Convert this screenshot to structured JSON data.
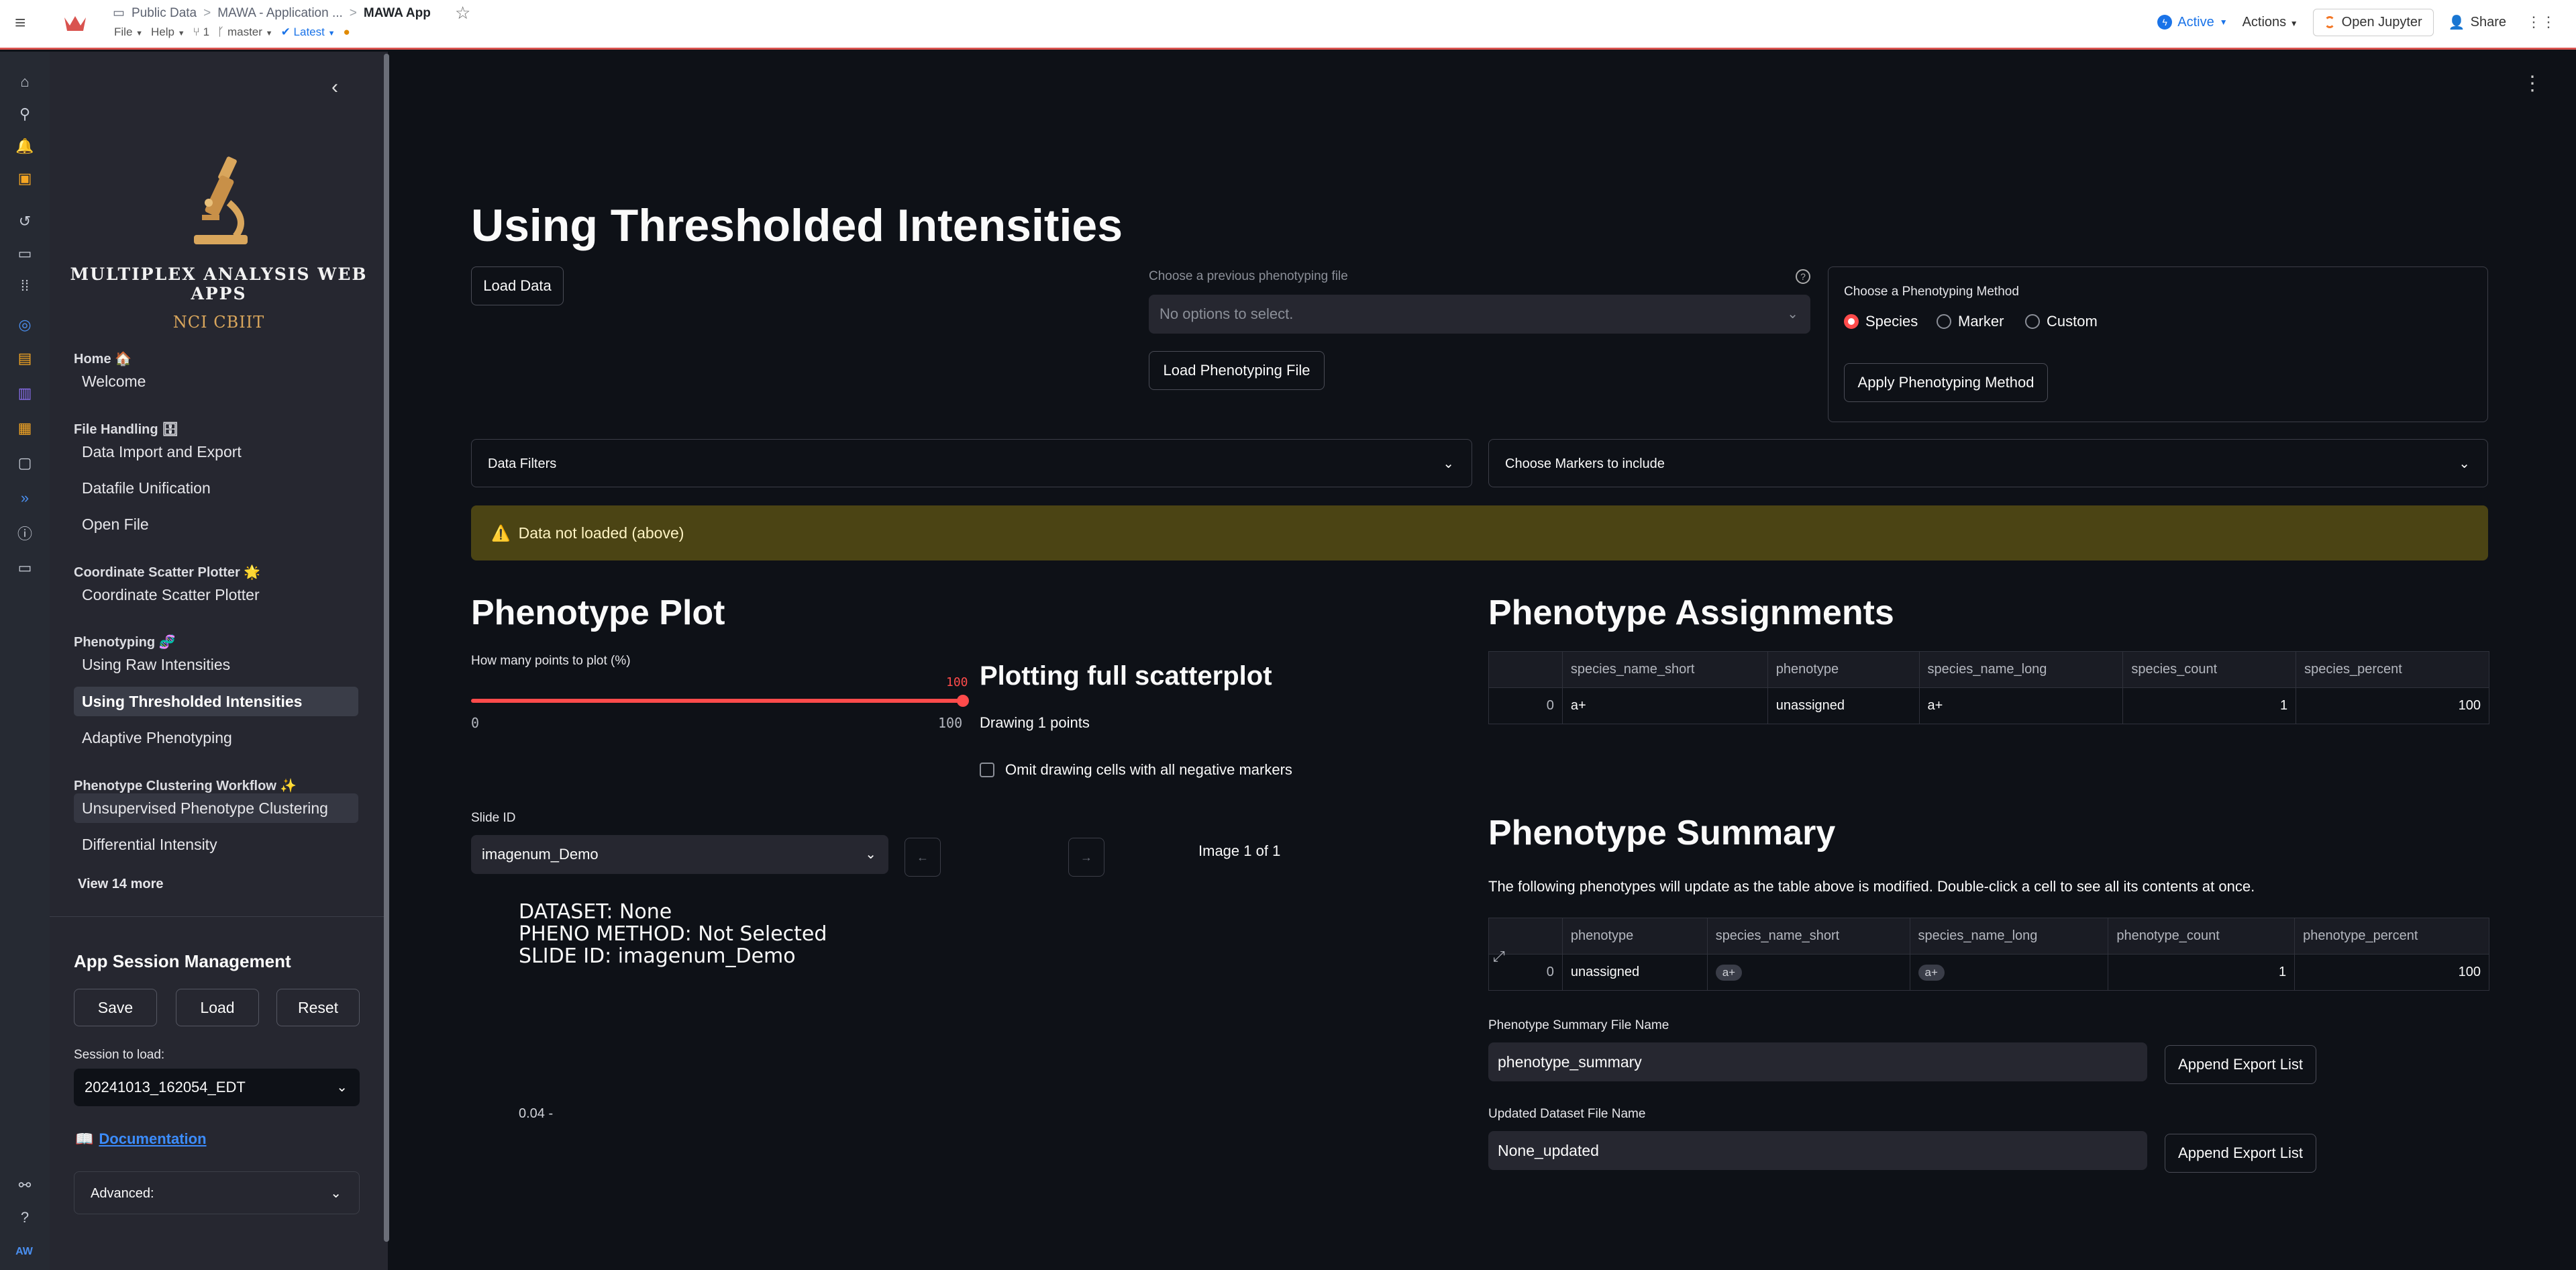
{
  "topbar": {
    "breadcrumb": [
      "Public Data",
      "MAWA - Application ...",
      "MAWA App"
    ],
    "menus": [
      "File",
      "Help"
    ],
    "branch_count": "1",
    "branch": "master",
    "version": "Latest",
    "status": "Active",
    "actions": "Actions",
    "open_jupyter": "Open Jupyter",
    "share": "Share"
  },
  "rail": {
    "avatar": "AW"
  },
  "sidebar": {
    "brand_title": "MULTIPLEX ANALYSIS WEB APPS",
    "brand_sub": "NCI CBIIT",
    "sections": [
      {
        "header": "Home 🏠",
        "items": [
          "Welcome"
        ]
      },
      {
        "header": "File Handling 🗄",
        "items": [
          "Data Import and Export",
          "Datafile Unification",
          "Open File"
        ]
      },
      {
        "header": "Coordinate Scatter Plotter 🌟",
        "items": [
          "Coordinate Scatter Plotter"
        ]
      },
      {
        "header": "Phenotyping 🧬",
        "items": [
          "Using Raw Intensities",
          "Using Thresholded Intensities",
          "Adaptive Phenotyping"
        ]
      },
      {
        "header": "Phenotype Clustering Workflow ✨",
        "items": [
          "Unsupervised Phenotype Clustering",
          "Differential Intensity"
        ]
      }
    ],
    "view_more": "View 14 more",
    "session_title": "App Session Management",
    "save": "Save",
    "load": "Load",
    "reset": "Reset",
    "session_label": "Session to load:",
    "session_value": "20241013_162054_EDT",
    "doc_link": "Documentation",
    "advanced": "Advanced:"
  },
  "main": {
    "title": "Using Thresholded Intensities",
    "load_data": "Load Data",
    "prev_file_label": "Choose a previous phenotyping file",
    "prev_file_placeholder": "No options to select.",
    "load_pheno_file": "Load Phenotyping File",
    "method_label": "Choose a Phenotyping Method",
    "methods": [
      "Species",
      "Marker",
      "Custom"
    ],
    "method_selected": "Species",
    "apply_method": "Apply Phenotyping Method",
    "data_filters": "Data Filters",
    "choose_markers": "Choose Markers to include",
    "warning": "Data not loaded (above)",
    "plot_title": "Phenotype Plot",
    "slider_label": "How many points to plot (%)",
    "slider_value": "100",
    "slider_min": "0",
    "slider_max": "100",
    "slider_fraction": 1.0,
    "plotting_title": "Plotting full scatterplot",
    "drawing": "Drawing 1 points",
    "omit_label": "Omit drawing cells with all negative markers",
    "slide_label": "Slide ID",
    "slide_value": "imagenum_Demo",
    "image_counter": "Image 1 of 1",
    "plot_info": "DATASET: None\nPHENO METHOD: Not Selected\nSLIDE ID: imagenum_Demo",
    "plot_tick": "0.04 -",
    "assign_title": "Phenotype Assignments",
    "assign_table": {
      "columns": [
        "",
        "species_name_short",
        "phenotype",
        "species_name_long",
        "species_count",
        "species_percent"
      ],
      "rows": [
        [
          "0",
          "a+",
          "unassigned",
          "a+",
          "1",
          "100"
        ]
      ]
    },
    "summary_title": "Phenotype Summary",
    "summary_desc": "The following phenotypes will update as the table above is modified. Double-click a cell to see all its contents at once.",
    "summary_table": {
      "columns": [
        "",
        "phenotype",
        "species_name_short",
        "species_name_long",
        "phenotype_count",
        "phenotype_percent"
      ],
      "rows": [
        [
          "0",
          "unassigned",
          "a+",
          "a+",
          "1",
          "100"
        ]
      ]
    },
    "summary_file_label": "Phenotype Summary File Name",
    "summary_file_value": "phenotype_summary",
    "append1": "Append Export List",
    "updated_label": "Updated Dataset File Name",
    "updated_value": "None_updated",
    "append2": "Append Export List"
  },
  "colors": {
    "accent": "#ff4b4b",
    "warning_bg": "#4b4414",
    "link": "#3c8dff"
  }
}
